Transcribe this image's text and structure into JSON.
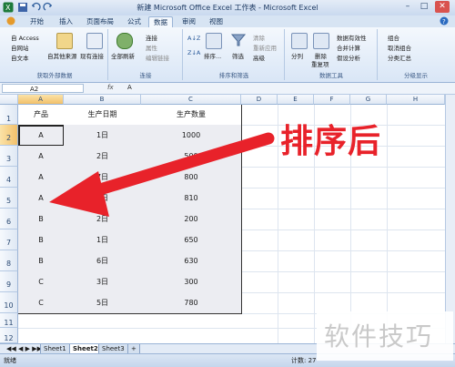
{
  "window": {
    "title": "新建 Microsoft Office Excel 工作表 - Microsoft Excel",
    "minimize": "–",
    "maximize": "□",
    "close": "✕"
  },
  "ribbon_tabs": [
    "开始",
    "插入",
    "页面布局",
    "公式",
    "数据",
    "审阅",
    "视图"
  ],
  "active_tab": "数据",
  "ribbon": {
    "group1": {
      "items": [
        "自 Access",
        "自网站",
        "自文本"
      ],
      "big": "自其他来源",
      "big2": "现有连接",
      "label": "获取外部数据"
    },
    "group2": {
      "big": "全部刷新",
      "items": [
        "连接",
        "属性",
        "编辑链接"
      ],
      "label": "连接"
    },
    "group3": {
      "az": "A↓Z",
      "za": "Z↓A",
      "sort": "排序...",
      "filter": "筛选",
      "items": [
        "清除",
        "重新应用",
        "高级"
      ],
      "label": "排序和筛选"
    },
    "group4": {
      "split": "分列",
      "dup1": "删除",
      "dup2": "重复项",
      "items": [
        "数据有效性",
        "合并计算",
        "假设分析"
      ],
      "label": "数据工具"
    },
    "group5": {
      "items": [
        "组合",
        "取消组合",
        "分类汇总"
      ],
      "label": "分级显示"
    }
  },
  "formula_bar": {
    "cell_ref": "A2",
    "fx": "fx",
    "value": "A"
  },
  "columns": [
    "A",
    "B",
    "C",
    "D",
    "E",
    "F",
    "G",
    "H"
  ],
  "rows": [
    "1",
    "2",
    "3",
    "4",
    "5",
    "6",
    "7",
    "8",
    "9",
    "10",
    "11",
    "12"
  ],
  "table": {
    "headers": [
      "产品",
      "生产日期",
      "生产数量"
    ],
    "rows": [
      [
        "A",
        "1日",
        "1000"
      ],
      [
        "A",
        "2日",
        "500"
      ],
      [
        "A",
        "7日",
        "800"
      ],
      [
        "A",
        "8日",
        "810"
      ],
      [
        "B",
        "2日",
        "200"
      ],
      [
        "B",
        "1日",
        "650"
      ],
      [
        "B",
        "6日",
        "630"
      ],
      [
        "C",
        "3日",
        "300"
      ],
      [
        "C",
        "5日",
        "780"
      ]
    ]
  },
  "sheets": [
    "Sheet1",
    "Sheet2",
    "Sheet3"
  ],
  "active_sheet": "Sheet2",
  "status": {
    "mode": "就绪",
    "count": "计数: 27"
  },
  "annotation": "排序后",
  "watermark": "软件技巧",
  "colors": {
    "accent": "#e8222a",
    "excel_green": "#1d7a3a",
    "ribbon_blue": "#d7e4f3"
  }
}
